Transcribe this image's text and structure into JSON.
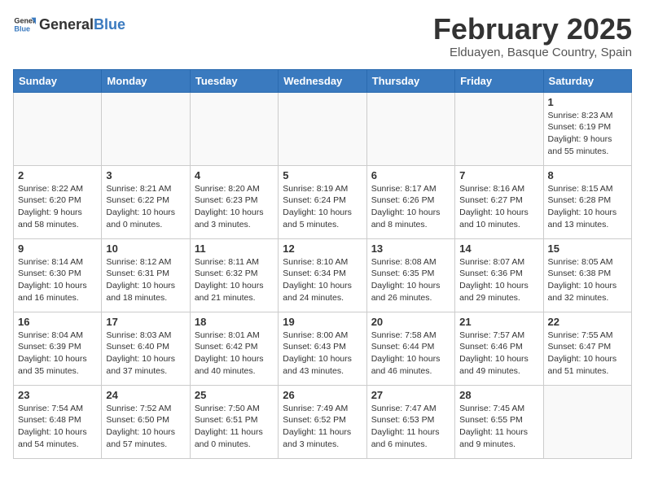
{
  "header": {
    "logo_general": "General",
    "logo_blue": "Blue",
    "month_title": "February 2025",
    "location": "Elduayen, Basque Country, Spain"
  },
  "weekdays": [
    "Sunday",
    "Monday",
    "Tuesday",
    "Wednesday",
    "Thursday",
    "Friday",
    "Saturday"
  ],
  "weeks": [
    [
      {
        "day": "",
        "info": ""
      },
      {
        "day": "",
        "info": ""
      },
      {
        "day": "",
        "info": ""
      },
      {
        "day": "",
        "info": ""
      },
      {
        "day": "",
        "info": ""
      },
      {
        "day": "",
        "info": ""
      },
      {
        "day": "1",
        "info": "Sunrise: 8:23 AM\nSunset: 6:19 PM\nDaylight: 9 hours and 55 minutes."
      }
    ],
    [
      {
        "day": "2",
        "info": "Sunrise: 8:22 AM\nSunset: 6:20 PM\nDaylight: 9 hours and 58 minutes."
      },
      {
        "day": "3",
        "info": "Sunrise: 8:21 AM\nSunset: 6:22 PM\nDaylight: 10 hours and 0 minutes."
      },
      {
        "day": "4",
        "info": "Sunrise: 8:20 AM\nSunset: 6:23 PM\nDaylight: 10 hours and 3 minutes."
      },
      {
        "day": "5",
        "info": "Sunrise: 8:19 AM\nSunset: 6:24 PM\nDaylight: 10 hours and 5 minutes."
      },
      {
        "day": "6",
        "info": "Sunrise: 8:17 AM\nSunset: 6:26 PM\nDaylight: 10 hours and 8 minutes."
      },
      {
        "day": "7",
        "info": "Sunrise: 8:16 AM\nSunset: 6:27 PM\nDaylight: 10 hours and 10 minutes."
      },
      {
        "day": "8",
        "info": "Sunrise: 8:15 AM\nSunset: 6:28 PM\nDaylight: 10 hours and 13 minutes."
      }
    ],
    [
      {
        "day": "9",
        "info": "Sunrise: 8:14 AM\nSunset: 6:30 PM\nDaylight: 10 hours and 16 minutes."
      },
      {
        "day": "10",
        "info": "Sunrise: 8:12 AM\nSunset: 6:31 PM\nDaylight: 10 hours and 18 minutes."
      },
      {
        "day": "11",
        "info": "Sunrise: 8:11 AM\nSunset: 6:32 PM\nDaylight: 10 hours and 21 minutes."
      },
      {
        "day": "12",
        "info": "Sunrise: 8:10 AM\nSunset: 6:34 PM\nDaylight: 10 hours and 24 minutes."
      },
      {
        "day": "13",
        "info": "Sunrise: 8:08 AM\nSunset: 6:35 PM\nDaylight: 10 hours and 26 minutes."
      },
      {
        "day": "14",
        "info": "Sunrise: 8:07 AM\nSunset: 6:36 PM\nDaylight: 10 hours and 29 minutes."
      },
      {
        "day": "15",
        "info": "Sunrise: 8:05 AM\nSunset: 6:38 PM\nDaylight: 10 hours and 32 minutes."
      }
    ],
    [
      {
        "day": "16",
        "info": "Sunrise: 8:04 AM\nSunset: 6:39 PM\nDaylight: 10 hours and 35 minutes."
      },
      {
        "day": "17",
        "info": "Sunrise: 8:03 AM\nSunset: 6:40 PM\nDaylight: 10 hours and 37 minutes."
      },
      {
        "day": "18",
        "info": "Sunrise: 8:01 AM\nSunset: 6:42 PM\nDaylight: 10 hours and 40 minutes."
      },
      {
        "day": "19",
        "info": "Sunrise: 8:00 AM\nSunset: 6:43 PM\nDaylight: 10 hours and 43 minutes."
      },
      {
        "day": "20",
        "info": "Sunrise: 7:58 AM\nSunset: 6:44 PM\nDaylight: 10 hours and 46 minutes."
      },
      {
        "day": "21",
        "info": "Sunrise: 7:57 AM\nSunset: 6:46 PM\nDaylight: 10 hours and 49 minutes."
      },
      {
        "day": "22",
        "info": "Sunrise: 7:55 AM\nSunset: 6:47 PM\nDaylight: 10 hours and 51 minutes."
      }
    ],
    [
      {
        "day": "23",
        "info": "Sunrise: 7:54 AM\nSunset: 6:48 PM\nDaylight: 10 hours and 54 minutes."
      },
      {
        "day": "24",
        "info": "Sunrise: 7:52 AM\nSunset: 6:50 PM\nDaylight: 10 hours and 57 minutes."
      },
      {
        "day": "25",
        "info": "Sunrise: 7:50 AM\nSunset: 6:51 PM\nDaylight: 11 hours and 0 minutes."
      },
      {
        "day": "26",
        "info": "Sunrise: 7:49 AM\nSunset: 6:52 PM\nDaylight: 11 hours and 3 minutes."
      },
      {
        "day": "27",
        "info": "Sunrise: 7:47 AM\nSunset: 6:53 PM\nDaylight: 11 hours and 6 minutes."
      },
      {
        "day": "28",
        "info": "Sunrise: 7:45 AM\nSunset: 6:55 PM\nDaylight: 11 hours and 9 minutes."
      },
      {
        "day": "",
        "info": ""
      }
    ]
  ]
}
